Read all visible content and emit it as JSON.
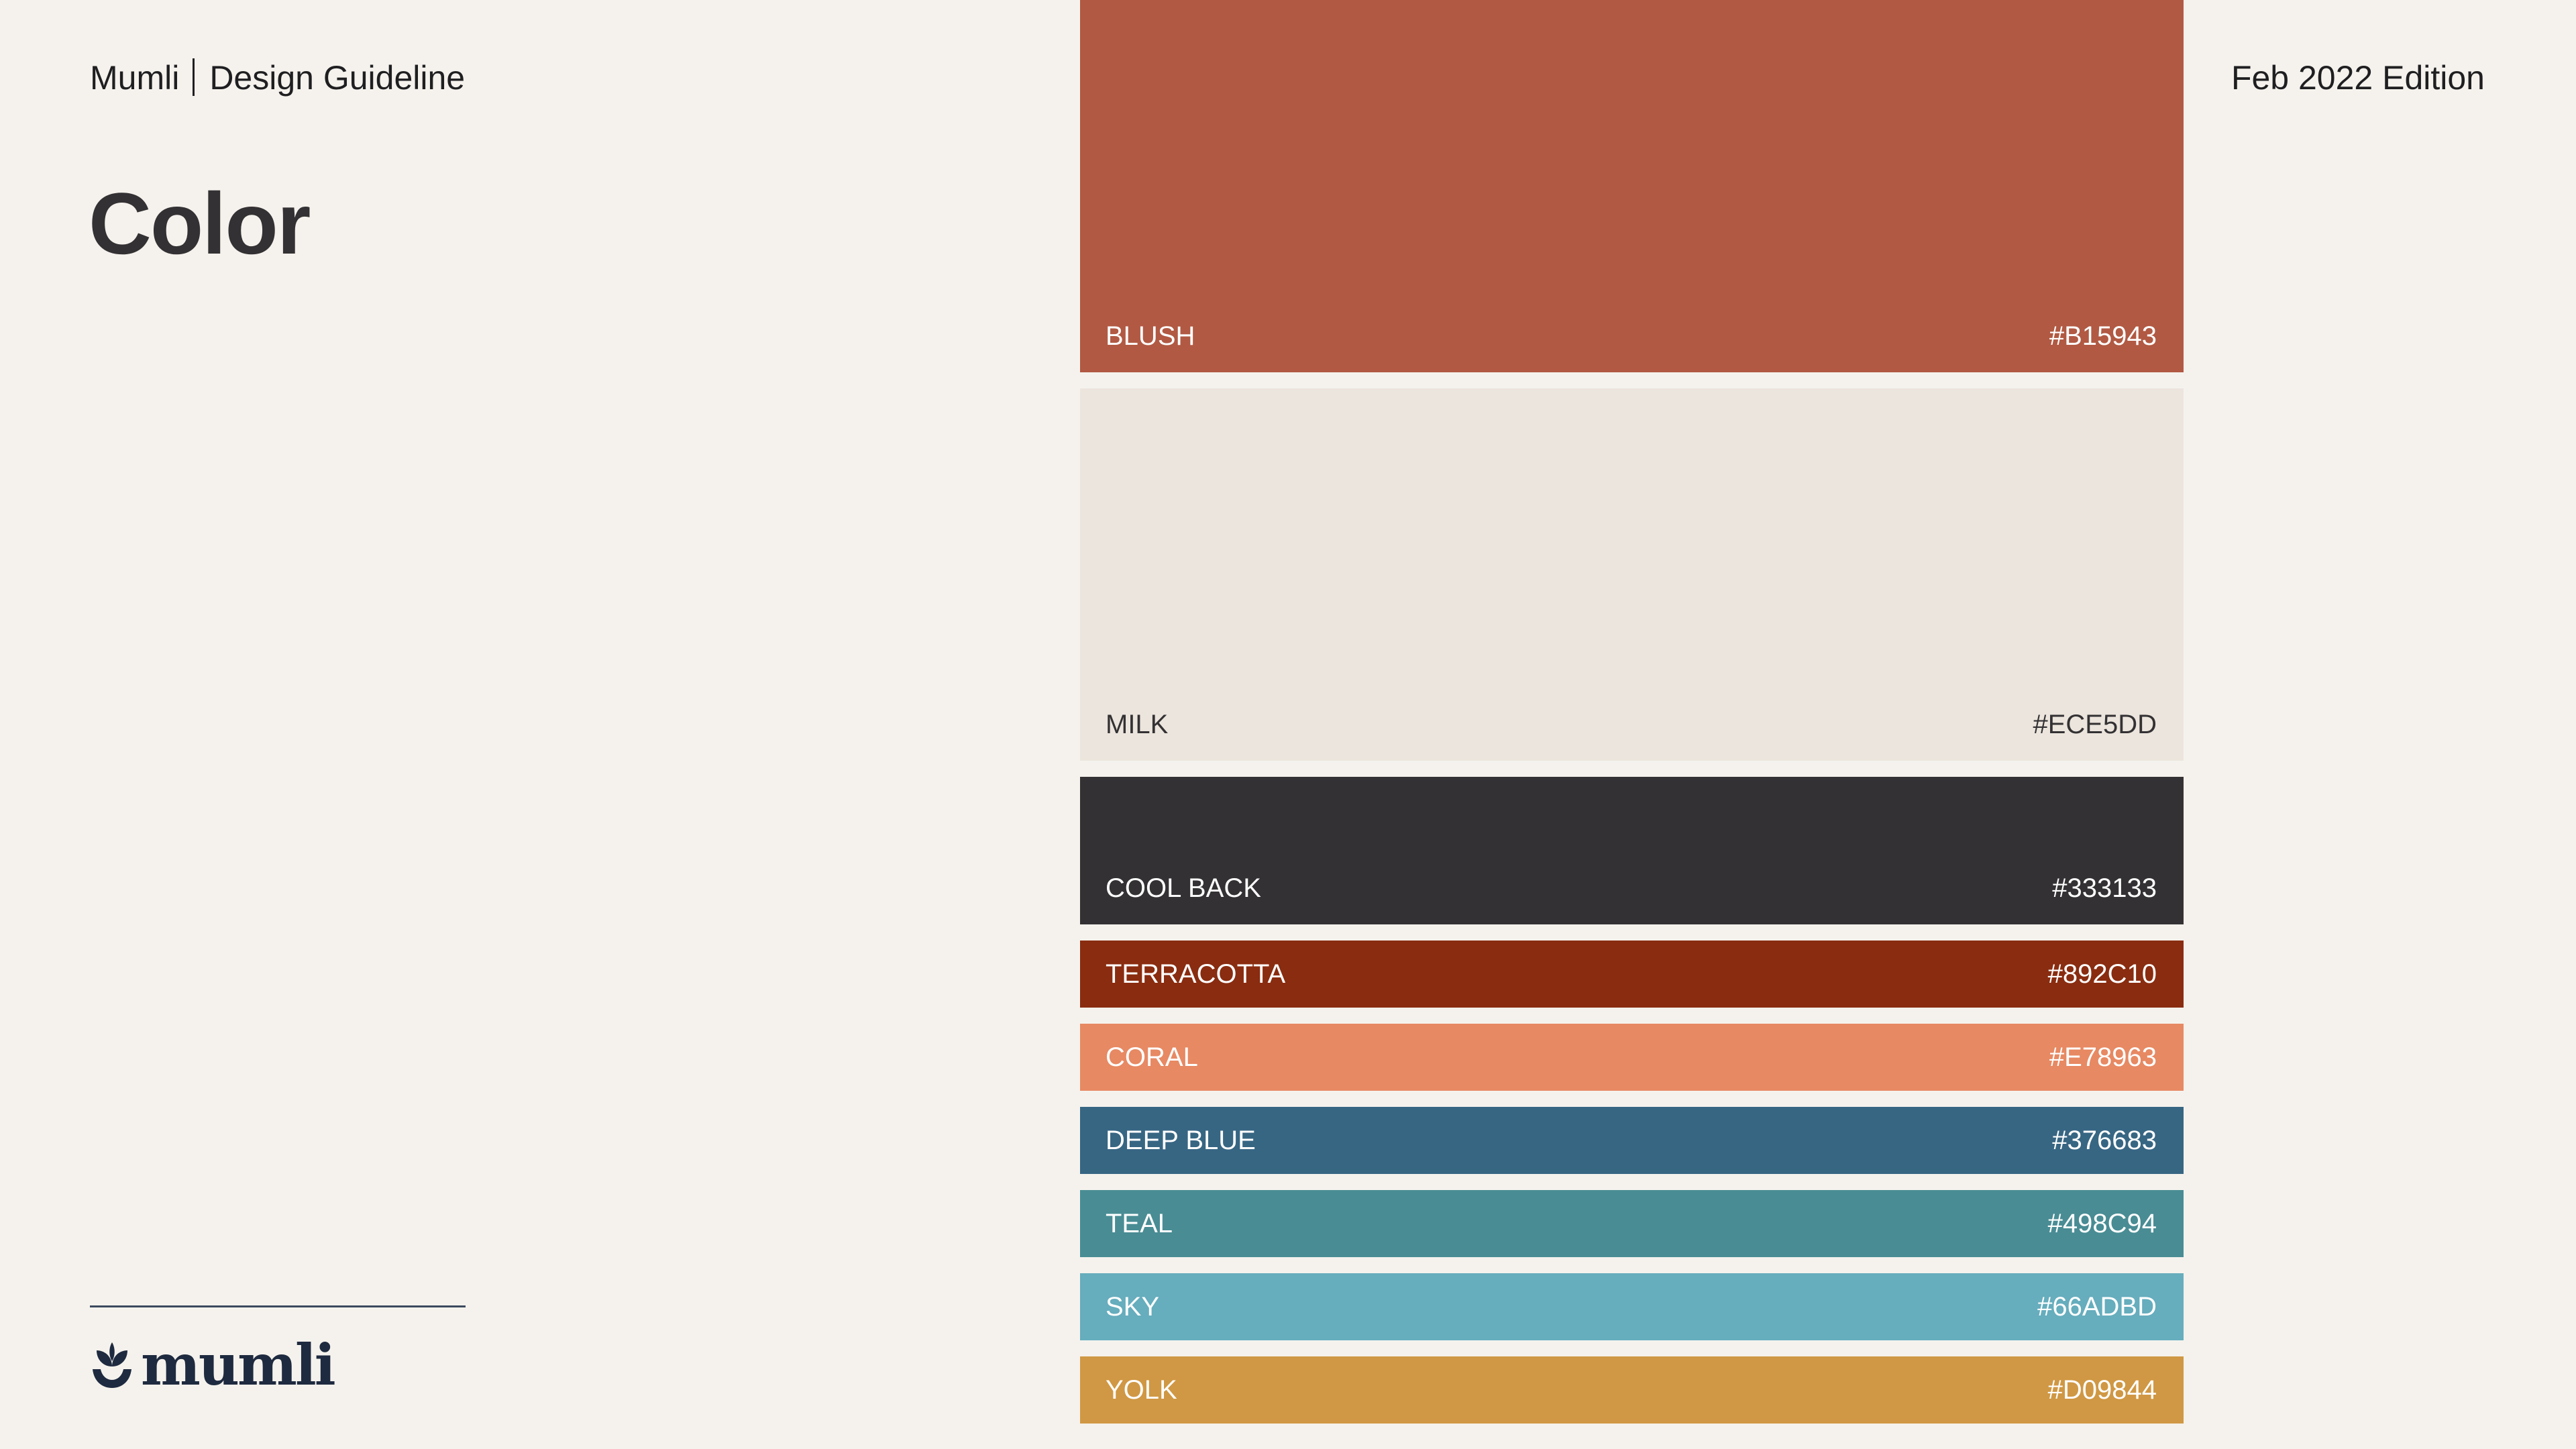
{
  "header": {
    "brand": "Mumli",
    "doc_title": "Design Guideline",
    "edition": "Feb 2022 Edition"
  },
  "page_title": "Color",
  "logo": {
    "wordmark": "mumli",
    "icon": "sprout-logo-icon"
  },
  "palette": [
    {
      "name": "BLUSH",
      "hex": "#B15943",
      "color": "#B15943",
      "text_color": "#FFFFFF"
    },
    {
      "name": "MILK",
      "hex": "#ECE5DD",
      "color": "#ECE5DD",
      "text_color": "#333133"
    },
    {
      "name": "COOL BACK",
      "hex": "#333133",
      "color": "#333133",
      "text_color": "#FFFFFF"
    },
    {
      "name": "TERRACOTTA",
      "hex": "#892C10",
      "color": "#892C10",
      "text_color": "#FFFFFF"
    },
    {
      "name": "CORAL",
      "hex": "#E78963",
      "color": "#E78963",
      "text_color": "#FFFFFF"
    },
    {
      "name": "DEEP BLUE",
      "hex": "#376683",
      "color": "#376683",
      "text_color": "#FFFFFF"
    },
    {
      "name": "TEAL",
      "hex": "#498C94",
      "color": "#498C94",
      "text_color": "#FFFFFF"
    },
    {
      "name": "SKY",
      "hex": "#66ADBD",
      "color": "#66ADBD",
      "text_color": "#FFFFFF"
    },
    {
      "name": "YOLK",
      "hex": "#D09844",
      "color": "#D09844",
      "text_color": "#FFFFFF"
    }
  ]
}
